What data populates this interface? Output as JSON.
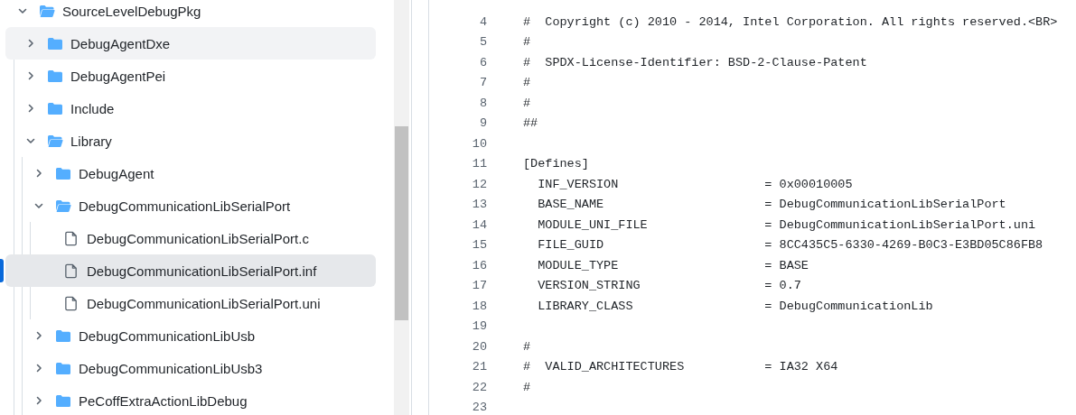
{
  "tree": [
    {
      "kind": "folder",
      "label": "SourceLevelDebugPkg",
      "expanded": true,
      "hovered": false,
      "selected": false,
      "children": [
        {
          "kind": "folder",
          "label": "DebugAgentDxe",
          "expanded": false,
          "hovered": true,
          "selected": false
        },
        {
          "kind": "folder",
          "label": "DebugAgentPei",
          "expanded": false,
          "hovered": false,
          "selected": false
        },
        {
          "kind": "folder",
          "label": "Include",
          "expanded": false,
          "hovered": false,
          "selected": false
        },
        {
          "kind": "folder",
          "label": "Library",
          "expanded": true,
          "hovered": false,
          "selected": false,
          "children": [
            {
              "kind": "folder",
              "label": "DebugAgent",
              "expanded": false,
              "hovered": false,
              "selected": false
            },
            {
              "kind": "folder",
              "label": "DebugCommunicationLibSerialPort",
              "expanded": true,
              "hovered": false,
              "selected": false,
              "children": [
                {
                  "kind": "file",
                  "label": "DebugCommunicationLibSerialPort.c",
                  "hovered": false,
                  "selected": false
                },
                {
                  "kind": "file",
                  "label": "DebugCommunicationLibSerialPort.inf",
                  "hovered": false,
                  "selected": true
                },
                {
                  "kind": "file",
                  "label": "DebugCommunicationLibSerialPort.uni",
                  "hovered": false,
                  "selected": false
                }
              ]
            },
            {
              "kind": "folder",
              "label": "DebugCommunicationLibUsb",
              "expanded": false,
              "hovered": false,
              "selected": false
            },
            {
              "kind": "folder",
              "label": "DebugCommunicationLibUsb3",
              "expanded": false,
              "hovered": false,
              "selected": false
            },
            {
              "kind": "folder",
              "label": "PeCoffExtraActionLibDebug",
              "expanded": false,
              "hovered": false,
              "selected": false
            }
          ]
        }
      ]
    }
  ],
  "code": {
    "lines": [
      {
        "number": "4",
        "text": "#  Copyright (c) 2010 - 2014, Intel Corporation. All rights reserved.<BR>"
      },
      {
        "number": "5",
        "text": "#"
      },
      {
        "number": "6",
        "text": "#  SPDX-License-Identifier: BSD-2-Clause-Patent"
      },
      {
        "number": "7",
        "text": "#"
      },
      {
        "number": "8",
        "text": "#"
      },
      {
        "number": "9",
        "text": "##"
      },
      {
        "number": "10"
      },
      {
        "number": "11",
        "text": "[Defines]"
      },
      {
        "number": "12",
        "text": "  INF_VERSION                    = 0x00010005"
      },
      {
        "number": "13",
        "text": "  BASE_NAME                      = DebugCommunicationLibSerialPort"
      },
      {
        "number": "14",
        "text": "  MODULE_UNI_FILE                = DebugCommunicationLibSerialPort.uni"
      },
      {
        "number": "15",
        "text": "  FILE_GUID                      = 8CC435C5-6330-4269-B0C3-E3BD05C86FB8"
      },
      {
        "number": "16",
        "text": "  MODULE_TYPE                    = BASE"
      },
      {
        "number": "17",
        "text": "  VERSION_STRING                 = 0.7"
      },
      {
        "number": "18",
        "text": "  LIBRARY_CLASS                  = DebugCommunicationLib"
      },
      {
        "number": "19"
      },
      {
        "number": "20",
        "text": "#"
      },
      {
        "number": "21",
        "text": "#  VALID_ARCHITECTURES           = IA32 X64"
      },
      {
        "number": "22",
        "text": "#"
      },
      {
        "number": "23"
      }
    ]
  }
}
